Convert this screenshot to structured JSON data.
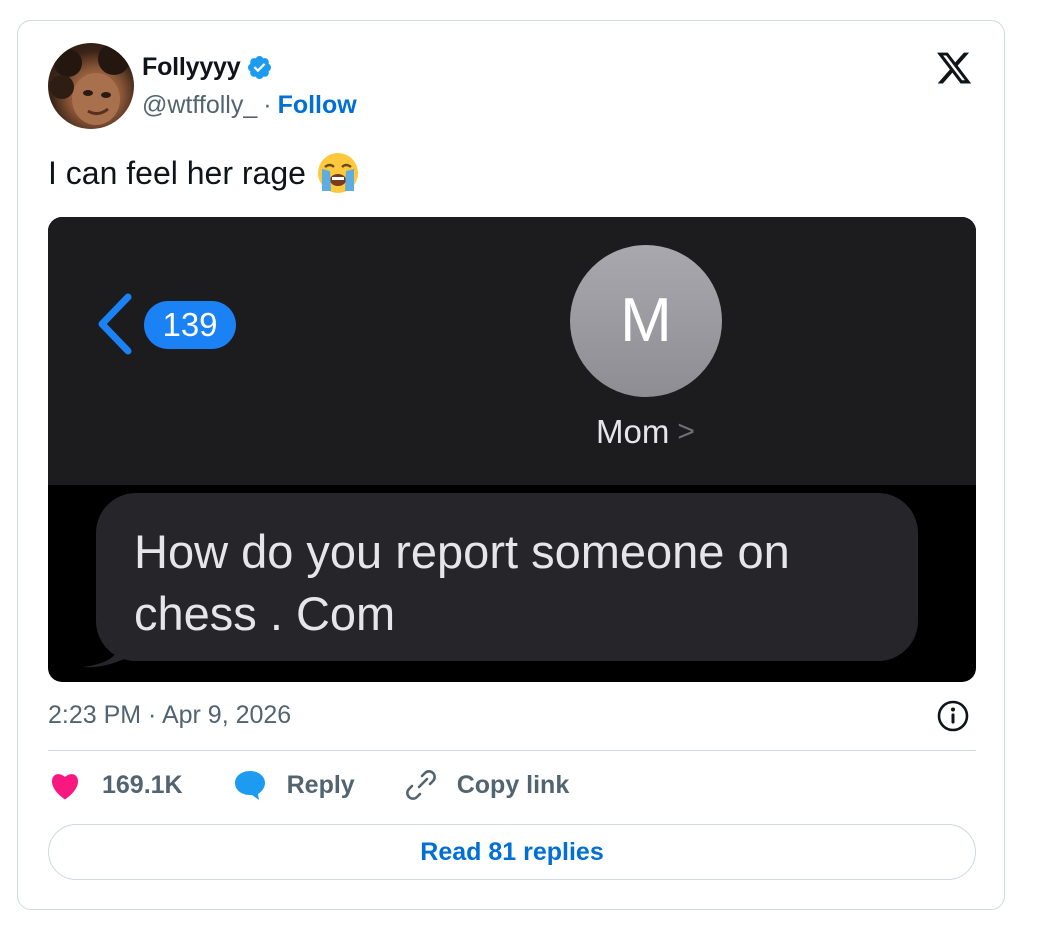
{
  "author": {
    "name": "Follyyyy",
    "handle": "@wtffolly_",
    "separator": "·",
    "follow_label": "Follow"
  },
  "tweet": {
    "text": "I can feel her rage",
    "emoji": "loudly-crying-face-emoji"
  },
  "media": {
    "unread_count": "139",
    "contact_initial": "M",
    "contact_name": "Mom",
    "contact_chevron": ">",
    "message_line1": "How do you report someone on",
    "message_line2": "chess . Com"
  },
  "meta": {
    "timestamp": "2:23 PM · Apr 9, 2026"
  },
  "actions": {
    "likes": "169.1K",
    "reply_label": "Reply",
    "copy_link_label": "Copy link"
  },
  "footer": {
    "read_replies_label": "Read 81 replies"
  },
  "colors": {
    "accent": "#006fd6",
    "like": "#f91880",
    "imessage_blue": "#1a82f5",
    "text_primary": "#0f1419",
    "text_secondary": "#536471"
  }
}
